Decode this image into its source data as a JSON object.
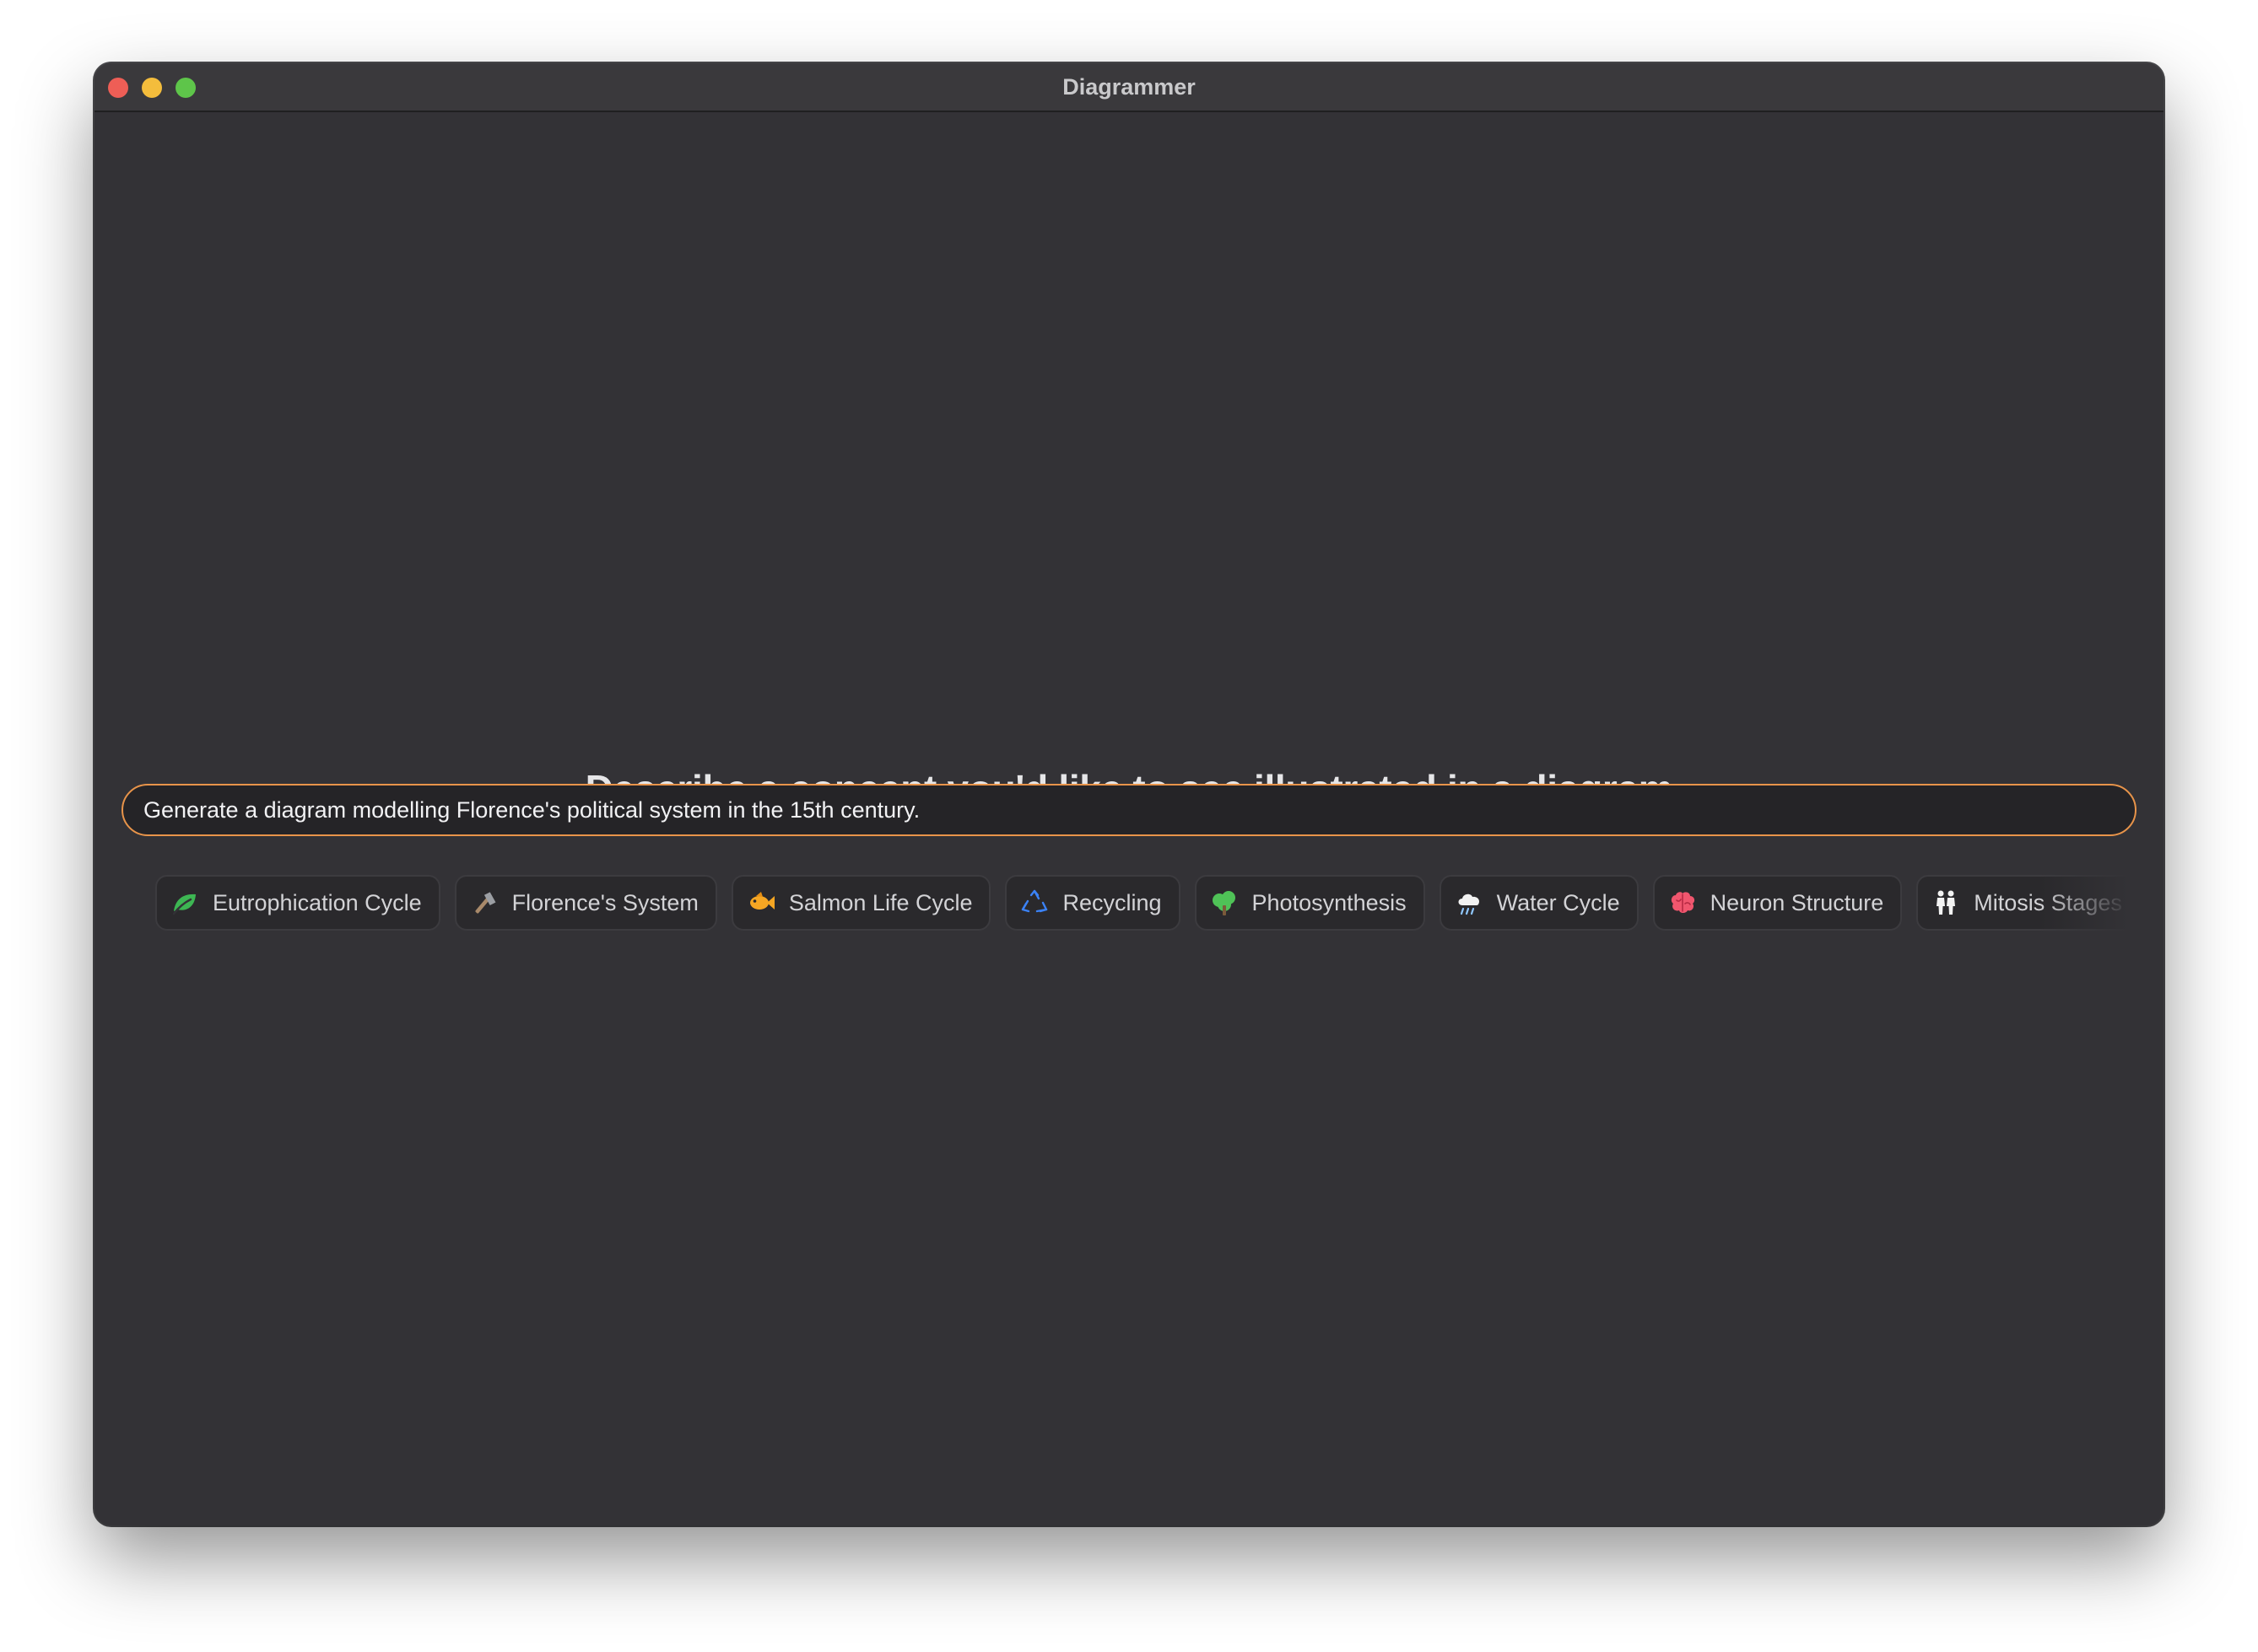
{
  "window": {
    "title": "Diagrammer"
  },
  "main": {
    "heading": "Describe a concept you'd like to see illustrated in a diagram",
    "prompt": {
      "value": "Generate a diagram modelling Florence's political system in the 15th century.",
      "accent_color": "#e8944a"
    }
  },
  "suggestions": [
    {
      "label": "Eutrophication Cycle",
      "icon": "leaf-icon",
      "color": "#3db653"
    },
    {
      "label": "Florence's System",
      "icon": "hammer-icon",
      "color": "#a8896a"
    },
    {
      "label": "Salmon Life Cycle",
      "icon": "fish-icon",
      "color": "#f5a623"
    },
    {
      "label": "Recycling",
      "icon": "recycle-icon",
      "color": "#3b82f6"
    },
    {
      "label": "Photosynthesis",
      "icon": "tree-icon",
      "color": "#4fc257"
    },
    {
      "label": "Water Cycle",
      "icon": "cloud-rain-icon",
      "color": "#f2f2f2"
    },
    {
      "label": "Neuron Structure",
      "icon": "brain-icon",
      "color": "#f0566e"
    },
    {
      "label": "Mitosis Stages",
      "icon": "people-icon",
      "color": "#f2f2f2"
    }
  ]
}
